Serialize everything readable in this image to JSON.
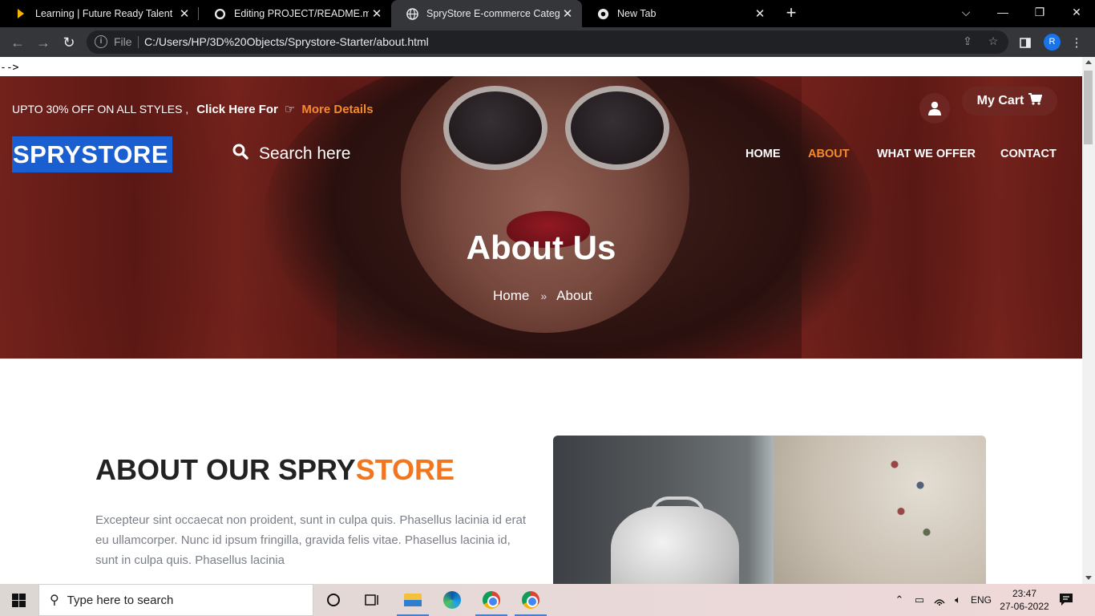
{
  "browser": {
    "tabs": [
      {
        "title": "Learning | Future Ready Talent",
        "active": false
      },
      {
        "title": "Editing PROJECT/README.md at",
        "active": false
      },
      {
        "title": "SpryStore E-commerce Category",
        "active": true
      },
      {
        "title": "New Tab",
        "active": false
      }
    ],
    "address": {
      "scheme_label": "File",
      "url": "C:/Users/HP/3D%20Objects/Sprystore-Starter/about.html"
    },
    "profile_initial": "R"
  },
  "page": {
    "stray_text": "-->",
    "promo": {
      "text": "UPTO 30% OFF ON ALL STYLES ,",
      "click": "Click Here For",
      "more": "More Details"
    },
    "cart_label": "My Cart",
    "logo": "SPRYSTORE",
    "search_placeholder": "Search here",
    "nav": [
      {
        "label": "HOME",
        "active": false
      },
      {
        "label": "ABOUT",
        "active": true
      },
      {
        "label": "WHAT WE OFFER",
        "active": false
      },
      {
        "label": "CONTACT",
        "active": false
      }
    ],
    "hero_title": "About Us",
    "breadcrumb": {
      "home": "Home",
      "current": "About"
    },
    "about": {
      "heading_main": "ABOUT OUR SPRY",
      "heading_accent": "STORE",
      "body": "Excepteur sint occaecat non proident, sunt in culpa quis. Phasellus lacinia id erat eu ullamcorper. Nunc id ipsum fringilla, gravida felis vitae. Phasellus lacinia id, sunt in culpa quis. Phasellus lacinia"
    },
    "colors": {
      "accent": "#f58a2c",
      "logo_bg": "#1a5fd1"
    }
  },
  "taskbar": {
    "search_placeholder": "Type here to search",
    "language": "ENG",
    "time": "23:47",
    "date": "27-06-2022"
  }
}
